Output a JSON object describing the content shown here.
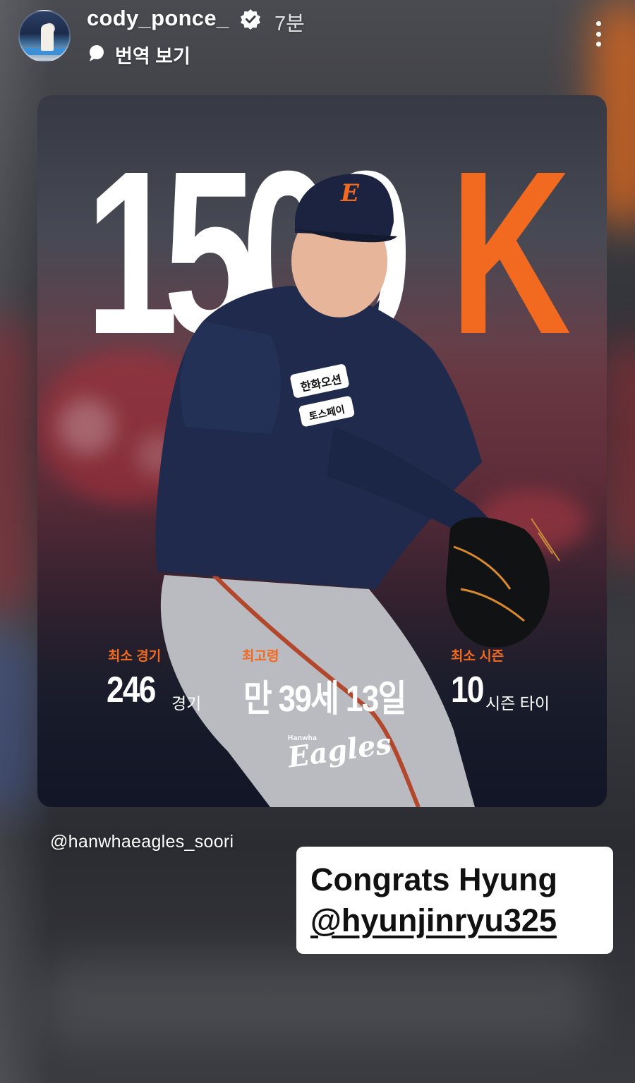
{
  "header": {
    "username": "cody_ponce_",
    "time_ago": "7분",
    "translate_label": "번역 보기"
  },
  "post": {
    "headline_number": "1500",
    "headline_k": "K",
    "stats": [
      {
        "label": "최소 경기",
        "value": "246",
        "unit": "경기"
      },
      {
        "label": "최고령",
        "value": "만 39세 13일",
        "unit": ""
      },
      {
        "label": "최소 시즌",
        "value": "10",
        "unit": "시즌 타이"
      }
    ],
    "team_small": "Hanwha",
    "team_script": "Eagles",
    "jersey_patch_1": "한화오션",
    "jersey_patch_2": "토스페이",
    "cap_letter": "E"
  },
  "credit": "@hanwhaeagles_soori",
  "caption": {
    "line1": "Congrats Hyung",
    "line2": "@hyunjinryu325"
  },
  "colors": {
    "accent_orange": "#f26a1f",
    "navy": "#1f2a4d",
    "white": "#ffffff"
  },
  "icons": {
    "verified": "verified-badge-icon",
    "translate": "translate-icon",
    "more": "more-vertical-icon"
  }
}
